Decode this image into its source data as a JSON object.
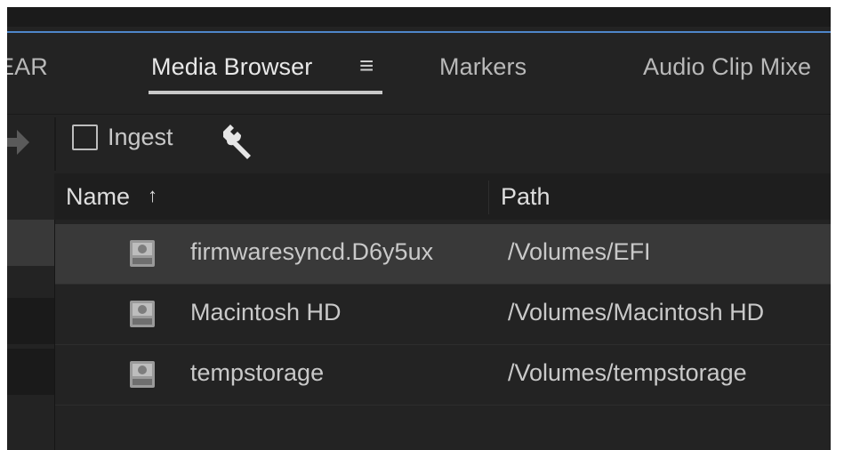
{
  "tabs": {
    "previous_partial": "EAR",
    "active": "Media Browser",
    "markers": "Markers",
    "audio_clip_mixer_partial": "Audio Clip Mixe"
  },
  "toolbar": {
    "ingest_label": "Ingest",
    "ingest_checked": false
  },
  "columns": {
    "name": "Name",
    "path": "Path",
    "sort_indicator": "↑"
  },
  "rows": [
    {
      "name": "firmwaresyncd.D6y5ux",
      "path": "/Volumes/EFI",
      "selected": true
    },
    {
      "name": "Macintosh HD",
      "path": "/Volumes/Macintosh HD",
      "selected": false
    },
    {
      "name": "tempstorage",
      "path": "/Volumes/tempstorage",
      "selected": false
    }
  ],
  "colors": {
    "panel_bg": "#232323",
    "selected_row": "#393939",
    "focus_line": "#4e86c9"
  },
  "icons": [
    "hamburger-menu-icon",
    "forward-arrow-icon",
    "wrench-icon",
    "sort-ascending-icon",
    "hard-drive-icon"
  ]
}
